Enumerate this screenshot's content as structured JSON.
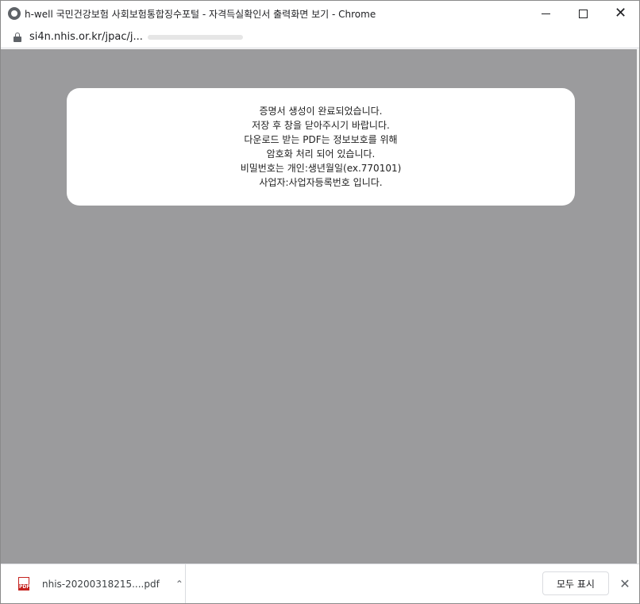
{
  "window": {
    "title": "h-well 국민건강보험 사회보험통합징수포털 - 자격득실확인서 출력화면 보기 - Chrome",
    "minimize_icon": "minimize-icon",
    "maximize_icon": "maximize-icon",
    "close_icon": "close-icon"
  },
  "address": {
    "url": "si4n.nhis.or.kr/jpac/j..."
  },
  "dialog": {
    "lines": [
      "증명서 생성이 완료되었습니다.",
      "저장 후 창을 닫아주시기 바랍니다.",
      "다운로드 받는 PDF는 정보보호를 위해",
      "암호화 처리 되어 있습니다.",
      "비밀번호는 개인:생년월일(ex.770101)",
      "사업자:사업자등록번호 입니다."
    ]
  },
  "downloads": {
    "file_name": "nhis-20200318215....pdf",
    "file_type_badge": "PDF",
    "show_all_label": "모두 표시",
    "chevron": "⌃",
    "close_symbol": "✕"
  },
  "colors": {
    "viewport_bg": "#9b9b9d",
    "dialog_bg": "#ffffff",
    "pdf_red": "#c5221f"
  }
}
